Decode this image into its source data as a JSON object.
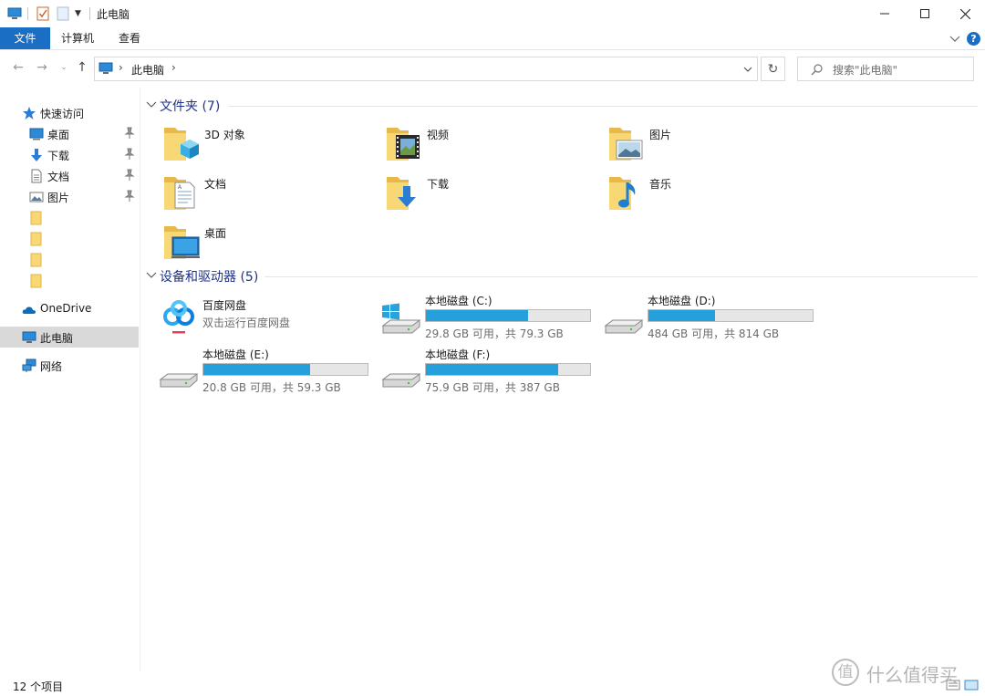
{
  "window": {
    "title": "此电脑"
  },
  "ribbon": {
    "tabs": [
      "文件",
      "计算机",
      "查看"
    ]
  },
  "address": {
    "location": "此电脑",
    "search_placeholder": "搜索\"此电脑\""
  },
  "navpane": {
    "quick_access": "快速访问",
    "pinned": [
      {
        "label": "桌面",
        "icon": "desktop-icon"
      },
      {
        "label": "下载",
        "icon": "download-icon"
      },
      {
        "label": "文档",
        "icon": "document-icon"
      },
      {
        "label": "图片",
        "icon": "picture-icon"
      }
    ],
    "onedrive": "OneDrive",
    "this_pc": "此电脑",
    "network": "网络"
  },
  "folders_group": {
    "title": "文件夹 (7)",
    "items": [
      {
        "name": "3D 对象",
        "icon": "3d-objects-folder-icon"
      },
      {
        "name": "视频",
        "icon": "videos-folder-icon"
      },
      {
        "name": "图片",
        "icon": "pictures-folder-icon"
      },
      {
        "name": "文档",
        "icon": "documents-folder-icon"
      },
      {
        "name": "下载",
        "icon": "downloads-folder-icon"
      },
      {
        "name": "音乐",
        "icon": "music-folder-icon"
      },
      {
        "name": "桌面",
        "icon": "desktop-folder-icon"
      }
    ]
  },
  "devices_group": {
    "title": "设备和驱动器 (5)",
    "baidu": {
      "name": "百度网盘",
      "subtitle": "双击运行百度网盘"
    },
    "drives": [
      {
        "name": "本地磁盘 (C:)",
        "free": "29.8 GB 可用，共 79.3 GB",
        "used_fraction": 0.624,
        "icon": "windows-drive-icon"
      },
      {
        "name": "本地磁盘 (D:)",
        "free": "484 GB 可用，共 814 GB",
        "used_fraction": 0.405,
        "icon": "hard-drive-icon"
      },
      {
        "name": "本地磁盘 (E:)",
        "free": "20.8 GB 可用，共 59.3 GB",
        "used_fraction": 0.649,
        "icon": "hard-drive-icon"
      },
      {
        "name": "本地磁盘 (F:)",
        "free": "75.9 GB 可用，共 387 GB",
        "used_fraction": 0.804,
        "icon": "hard-drive-icon"
      }
    ]
  },
  "status": {
    "items": "12 个项目"
  },
  "watermark": {
    "text": "什么值得买",
    "mark": "值"
  },
  "colors": {
    "accent": "#1a6fc4",
    "bar_fill": "#26a0da",
    "group_title": "#1e3287"
  }
}
